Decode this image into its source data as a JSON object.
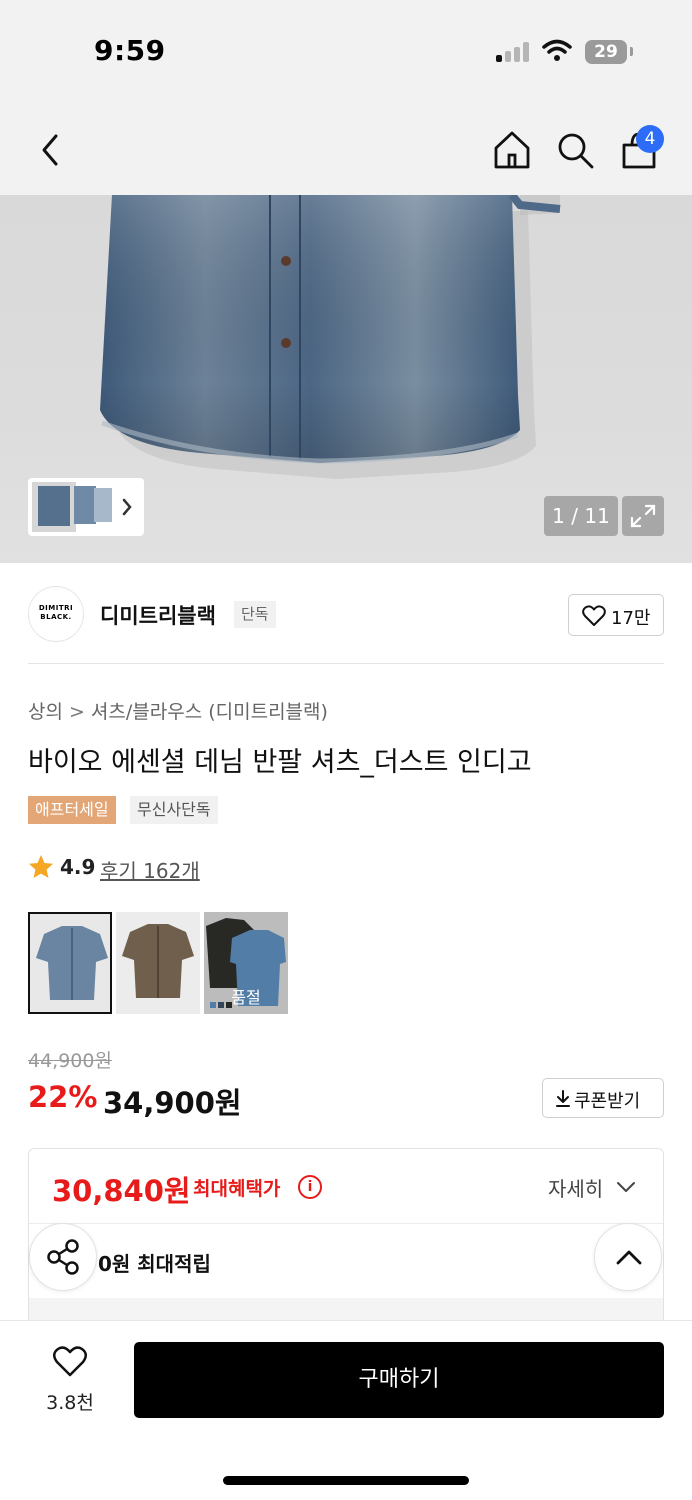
{
  "status_bar": {
    "time": "9:59",
    "battery": "29"
  },
  "header": {
    "cart_count": "4"
  },
  "gallery": {
    "counter": "1 / 11"
  },
  "brand": {
    "logo_line1": "DIMITRI",
    "logo_line2": "BLACK.",
    "name": "디미트리블랙",
    "tag": "단독",
    "likes": "17만"
  },
  "breadcrumb": {
    "category": "상의",
    "separator": ">",
    "subcategory": "셔츠/블라우스 (디미트리블랙)"
  },
  "product": {
    "title": "바이오 에센셜 데님 반팔 셔츠_더스트 인디고",
    "badges": [
      "애프터세일",
      "무신사단독"
    ],
    "rating": "4.9",
    "reviews": "후기 162개",
    "swatch_soldout": "품절",
    "original_price": "44,900원",
    "discount": "22%",
    "price": "34,900원",
    "coupon_label": "쿠폰받기"
  },
  "benefit": {
    "max_price": "30,840원",
    "max_label": "최대혜택가",
    "detail": "자세히",
    "points": "0원 최대적립"
  },
  "bottom": {
    "wish_count": "3.8천",
    "buy_label": "구매하기"
  },
  "colors": {
    "accent_red": "#e81b1b",
    "badge_blue": "#2c6cf6",
    "sale_badge": "#e3a777"
  }
}
